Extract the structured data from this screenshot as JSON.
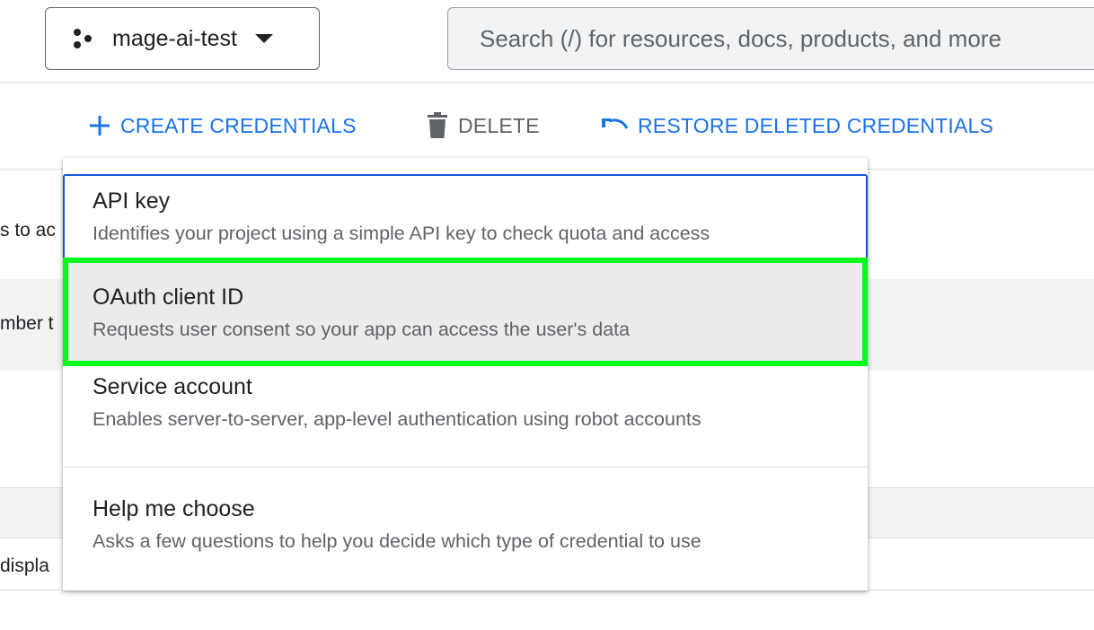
{
  "header": {
    "project_name": "mage-ai-test",
    "search_placeholder": "Search (/) for resources, docs, products, and more"
  },
  "toolbar": {
    "create_label": "CREATE CREDENTIALS",
    "delete_label": "DELETE",
    "restore_label": "RESTORE DELETED CREDENTIALS"
  },
  "background_rows": {
    "row1_text": "s to ac",
    "row2_text": "mber t",
    "row5_text": "displa"
  },
  "menu": {
    "items": [
      {
        "title": "API key",
        "description": "Identifies your project using a simple API key to check quota and access"
      },
      {
        "title": "OAuth client ID",
        "description": "Requests user consent so your app can access the user's data"
      },
      {
        "title": "Service account",
        "description": "Enables server-to-server, app-level authentication using robot accounts"
      },
      {
        "title": "Help me choose",
        "description": "Asks a few questions to help you decide which type of credential to use"
      }
    ]
  },
  "colors": {
    "accent": "#1a73e8",
    "highlight_outline": "#00ff1a",
    "focus_border": "#1a4fd6"
  },
  "icons": {
    "project": "project-hub-icon",
    "dropdown": "caret-down-icon",
    "create": "plus-icon",
    "delete": "trash-icon",
    "restore": "undo-icon"
  }
}
